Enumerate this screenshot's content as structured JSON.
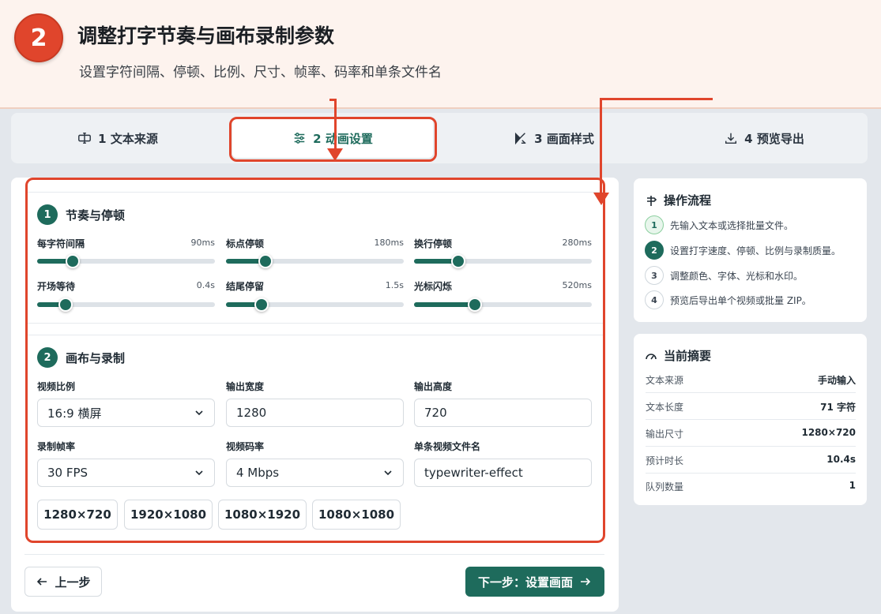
{
  "banner": {
    "step": "2",
    "title": "调整打字节奏与画布录制参数",
    "subtitle": "设置字符间隔、停顿、比例、尺寸、帧率、码率和单条文件名"
  },
  "tabs": [
    {
      "label": "1 文本来源",
      "icon": "text-cursor-icon"
    },
    {
      "label": "2 动画设置",
      "icon": "sliders-icon",
      "active": true
    },
    {
      "label": "3 画面样式",
      "icon": "palette-icon"
    },
    {
      "label": "4 预览导出",
      "icon": "download-icon"
    }
  ],
  "rhythm": {
    "number": "1",
    "title": "节奏与停顿",
    "sliders": [
      {
        "label": "每字符间隔",
        "value": "90ms",
        "fraction": 0.2
      },
      {
        "label": "标点停顿",
        "value": "180ms",
        "fraction": 0.22
      },
      {
        "label": "换行停顿",
        "value": "280ms",
        "fraction": 0.25
      },
      {
        "label": "开场等待",
        "value": "0.4s",
        "fraction": 0.16
      },
      {
        "label": "结尾停留",
        "value": "1.5s",
        "fraction": 0.2
      },
      {
        "label": "光标闪烁",
        "value": "520ms",
        "fraction": 0.34
      }
    ]
  },
  "canvas": {
    "number": "2",
    "title": "画布与录制",
    "ratio_label": "视频比例",
    "ratio_value": "16:9 横屏",
    "width_label": "输出宽度",
    "width_value": "1280",
    "height_label": "输出高度",
    "height_value": "720",
    "fps_label": "录制帧率",
    "fps_value": "30 FPS",
    "bitrate_label": "视频码率",
    "bitrate_value": "4 Mbps",
    "filename_label": "单条视频文件名",
    "filename_value": "typewriter-effect",
    "presets": [
      "1280×720",
      "1920×1080",
      "1080×1920",
      "1080×1080"
    ]
  },
  "nav": {
    "prev": "上一步",
    "next": "下一步：设置画面"
  },
  "flow": {
    "title": "操作流程",
    "items": [
      {
        "num": "1",
        "text": "先输入文本或选择批量文件。",
        "state": "done"
      },
      {
        "num": "2",
        "text": "设置打字速度、停顿、比例与录制质量。",
        "state": "active"
      },
      {
        "num": "3",
        "text": "调整颜色、字体、光标和水印。",
        "state": "todo"
      },
      {
        "num": "4",
        "text": "预览后导出单个视频或批量 ZIP。",
        "state": "todo"
      }
    ]
  },
  "summary": {
    "title": "当前摘要",
    "rows": [
      {
        "key": "文本来源",
        "value": "手动输入"
      },
      {
        "key": "文本长度",
        "value": "71 字符"
      },
      {
        "key": "输出尺寸",
        "value": "1280×720"
      },
      {
        "key": "预计时长",
        "value": "10.4s"
      },
      {
        "key": "队列数量",
        "value": "1"
      }
    ]
  },
  "colors": {
    "accent": "#1e6b5c",
    "highlight": "#e0452c",
    "banner_bg": "#fdf3ee"
  }
}
